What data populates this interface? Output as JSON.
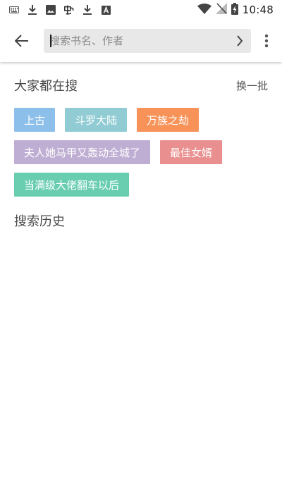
{
  "status_bar": {
    "time": "10:48",
    "left_icons": [
      "keyboard-icon",
      "download-icon",
      "image-icon",
      "app-icon",
      "download-icon",
      "font-icon"
    ],
    "right_icons": [
      "wifi-icon",
      "no-signal-icon",
      "battery-charging-icon"
    ]
  },
  "search": {
    "placeholder": "搜索书名、作者",
    "value": ""
  },
  "hot": {
    "title": "大家都在搜",
    "refresh_label": "换一批",
    "tags": [
      {
        "label": "上古",
        "color": "#8cc0ea"
      },
      {
        "label": "斗罗大陆",
        "color": "#91cbd3"
      },
      {
        "label": "万族之劫",
        "color": "#f79359"
      },
      {
        "label": "夫人她马甲又轰动全城了",
        "color": "#bfaed3"
      },
      {
        "label": "最佳女婿",
        "color": "#e98f8f"
      },
      {
        "label": "当满级大佬翻车以后",
        "color": "#69cdb0"
      }
    ]
  },
  "history": {
    "title": "搜索历史"
  }
}
